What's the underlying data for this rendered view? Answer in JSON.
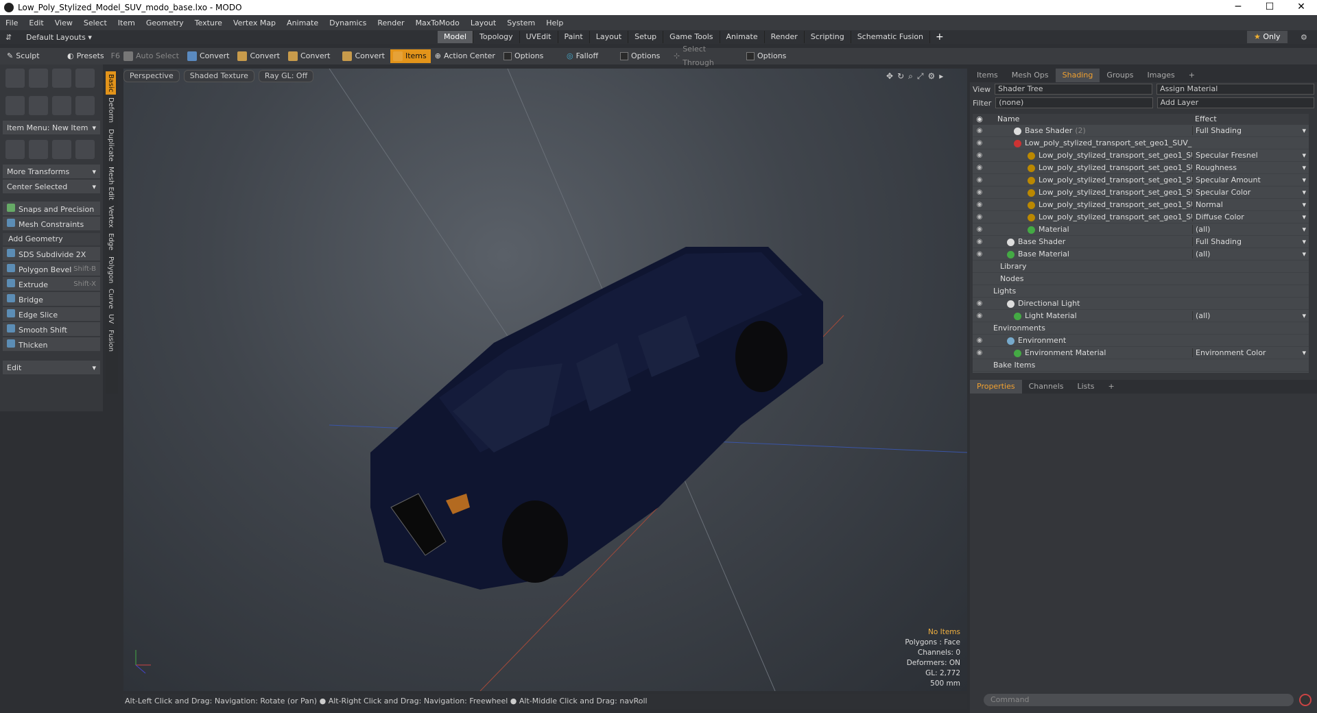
{
  "window": {
    "title": "Low_Poly_Stylized_Model_SUV_modo_base.lxo - MODO"
  },
  "menu": [
    "File",
    "Edit",
    "View",
    "Select",
    "Item",
    "Geometry",
    "Texture",
    "Vertex Map",
    "Animate",
    "Dynamics",
    "Render",
    "MaxToModo",
    "Layout",
    "System",
    "Help"
  ],
  "layouts": {
    "default_label": "Default Layouts",
    "tabs": [
      "Model",
      "Topology",
      "UVEdit",
      "Paint",
      "Layout",
      "Setup",
      "Game Tools",
      "Animate",
      "Render",
      "Scripting",
      "Schematic Fusion"
    ],
    "active": "Model",
    "only_label": "Only"
  },
  "toolbar": {
    "sculpt": "Sculpt",
    "presets": "Presets",
    "presets_key": "F6",
    "auto_select": "Auto Select",
    "convert1": "Convert",
    "convert2": "Convert",
    "convert3": "Convert",
    "convert4": "Convert",
    "items": "Items",
    "action_center": "Action Center",
    "options1": "Options",
    "falloff": "Falloff",
    "options2": "Options",
    "select_through": "Select Through",
    "options3": "Options"
  },
  "left": {
    "item_menu": "Item Menu: New Item",
    "more_transforms": "More Transforms",
    "center_selected": "Center Selected",
    "snaps": "Snaps and Precision",
    "mesh_constraints": "Mesh Constraints",
    "add_geometry": "Add Geometry",
    "tools": [
      {
        "label": "SDS Subdivide 2X",
        "shortcut": ""
      },
      {
        "label": "Polygon Bevel",
        "shortcut": "Shift-B"
      },
      {
        "label": "Extrude",
        "shortcut": "Shift-X"
      },
      {
        "label": "Bridge",
        "shortcut": ""
      },
      {
        "label": "Edge Slice",
        "shortcut": ""
      },
      {
        "label": "Smooth Shift",
        "shortcut": ""
      },
      {
        "label": "Thicken",
        "shortcut": ""
      }
    ],
    "edit": "Edit",
    "vtabs": [
      "Basic",
      "Deform",
      "Duplicate",
      "Mesh Edit",
      "Vertex",
      "Edge",
      "Polygon",
      "Curve",
      "UV",
      "Fusion"
    ]
  },
  "viewport": {
    "perspective": "Perspective",
    "shaded": "Shaded Texture",
    "raygl": "Ray GL: Off",
    "stats": {
      "no_items": "No Items",
      "polygons": "Polygons : Face",
      "channels": "Channels: 0",
      "deformers": "Deformers: ON",
      "gl": "GL: 2,772",
      "size": "500 mm"
    }
  },
  "status": "Alt-Left Click and Drag: Navigation: Rotate (or Pan) ● Alt-Right Click and Drag: Navigation: Freewheel ● Alt-Middle Click and Drag: navRoll",
  "right": {
    "tabs": [
      "Items",
      "Mesh Ops",
      "Shading",
      "Groups",
      "Images"
    ],
    "active_tab": "Shading",
    "view_label": "View",
    "view_value": "Shader Tree",
    "assign_material": "Assign Material",
    "filter_label": "Filter",
    "filter_value": "(none)",
    "add_layer": "Add Layer",
    "col_name": "Name",
    "col_effect": "Effect",
    "rows": [
      {
        "name": "Base Shader",
        "extra": "(2)",
        "effect": "Full Shading",
        "indent": 40,
        "dot": "#ddd"
      },
      {
        "name": "Low_poly_stylized_transport_set_geo1_SUV_ ...",
        "extra": "",
        "effect": "",
        "indent": 40,
        "dot": "#c33"
      },
      {
        "name": "Low_poly_stylized_transport_set_geo1_SU ...",
        "extra": "",
        "effect": "Specular Fresnel",
        "indent": 60,
        "dot": "#b80"
      },
      {
        "name": "Low_poly_stylized_transport_set_geo1_SU ...",
        "extra": "",
        "effect": "Roughness",
        "indent": 60,
        "dot": "#b80"
      },
      {
        "name": "Low_poly_stylized_transport_set_geo1_SU ...",
        "extra": "",
        "effect": "Specular Amount",
        "indent": 60,
        "dot": "#b80"
      },
      {
        "name": "Low_poly_stylized_transport_set_geo1_SU ...",
        "extra": "",
        "effect": "Specular Color",
        "indent": 60,
        "dot": "#b80"
      },
      {
        "name": "Low_poly_stylized_transport_set_geo1_SU ...",
        "extra": "",
        "effect": "Normal",
        "indent": 60,
        "dot": "#b80"
      },
      {
        "name": "Low_poly_stylized_transport_set_geo1_SU ...",
        "extra": "",
        "effect": "Diffuse Color",
        "indent": 60,
        "dot": "#b80"
      },
      {
        "name": "Material",
        "extra": "",
        "effect": "(all)",
        "indent": 60,
        "dot": "#4a4"
      },
      {
        "name": "Base Shader",
        "extra": "",
        "effect": "Full Shading",
        "indent": 30,
        "dot": "#ddd"
      },
      {
        "name": "Base Material",
        "extra": "",
        "effect": "(all)",
        "indent": 30,
        "dot": "#4a4"
      },
      {
        "name": "Library",
        "extra": "",
        "effect": "",
        "indent": 20,
        "dot": ""
      },
      {
        "name": "Nodes",
        "extra": "",
        "effect": "",
        "indent": 20,
        "dot": ""
      },
      {
        "name": "Lights",
        "extra": "",
        "effect": "",
        "indent": 10,
        "dot": ""
      },
      {
        "name": "Directional Light",
        "extra": "",
        "effect": "",
        "indent": 30,
        "dot": "#ddd"
      },
      {
        "name": "Light Material",
        "extra": "",
        "effect": "(all)",
        "indent": 40,
        "dot": "#4a4"
      },
      {
        "name": "Environments",
        "extra": "",
        "effect": "",
        "indent": 10,
        "dot": ""
      },
      {
        "name": "Environment",
        "extra": "",
        "effect": "",
        "indent": 30,
        "dot": "#7ac"
      },
      {
        "name": "Environment Material",
        "extra": "",
        "effect": "Environment Color",
        "indent": 40,
        "dot": "#4a4"
      },
      {
        "name": "Bake Items",
        "extra": "",
        "effect": "",
        "indent": 10,
        "dot": ""
      }
    ],
    "prop_tabs": [
      "Properties",
      "Channels",
      "Lists"
    ],
    "command_placeholder": "Command"
  }
}
